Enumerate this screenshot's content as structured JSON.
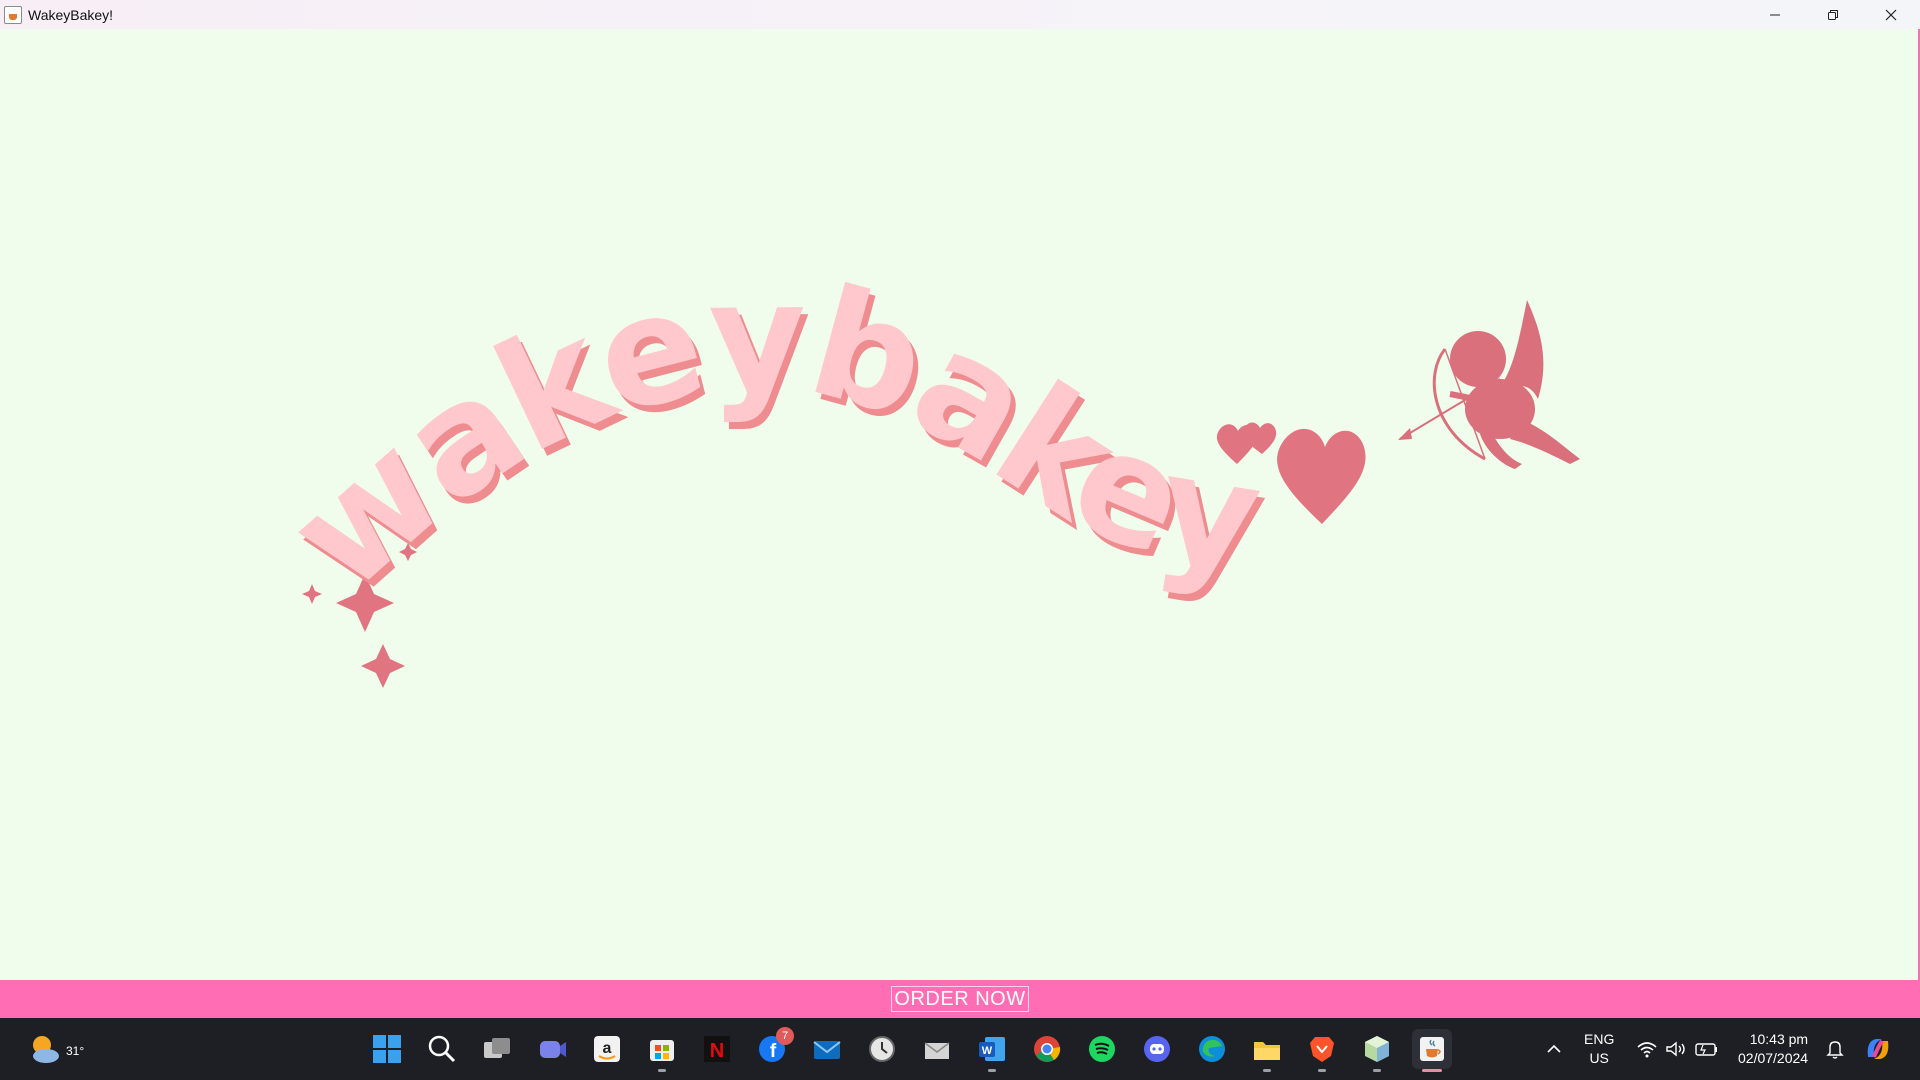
{
  "window": {
    "title": "WakeyBakey!",
    "controls": [
      "minimize",
      "restore",
      "close"
    ]
  },
  "logo": {
    "wordmark": "wakeybakey",
    "icons": [
      "sparkle-icon",
      "heart-icon",
      "cupid-icon"
    ],
    "colors": {
      "letters": "#ffc8cc",
      "shadow": "#ee8c90",
      "accent": "#e07480"
    }
  },
  "order_bar": {
    "button_label": "ORDER NOW",
    "background": "#ff6eb4"
  },
  "taskbar": {
    "weather_temp": "31°",
    "apps": [
      {
        "name": "start",
        "icon": "windows-logo-icon"
      },
      {
        "name": "search",
        "icon": "search-icon"
      },
      {
        "name": "task-view",
        "icon": "task-view-icon"
      },
      {
        "name": "teams",
        "icon": "video-chat-icon"
      },
      {
        "name": "amazon",
        "icon": "amazon-icon"
      },
      {
        "name": "store",
        "icon": "store-icon"
      },
      {
        "name": "netflix",
        "icon": "netflix-icon"
      },
      {
        "name": "facebook",
        "icon": "facebook-icon",
        "badge": "7"
      },
      {
        "name": "mail",
        "icon": "mail-icon"
      },
      {
        "name": "clock",
        "icon": "clock-icon"
      },
      {
        "name": "email",
        "icon": "envelope-icon"
      },
      {
        "name": "word",
        "icon": "word-icon"
      },
      {
        "name": "chrome",
        "icon": "chrome-icon"
      },
      {
        "name": "spotify",
        "icon": "spotify-icon"
      },
      {
        "name": "discord",
        "icon": "discord-icon"
      },
      {
        "name": "edge",
        "icon": "edge-icon"
      },
      {
        "name": "file-explorer",
        "icon": "folder-icon"
      },
      {
        "name": "brave",
        "icon": "brave-icon"
      },
      {
        "name": "app-cube",
        "icon": "cube-icon"
      },
      {
        "name": "java",
        "icon": "java-icon"
      }
    ],
    "language": {
      "line1": "ENG",
      "line2": "US"
    },
    "time": "10:43 pm",
    "date": "02/07/2024"
  }
}
